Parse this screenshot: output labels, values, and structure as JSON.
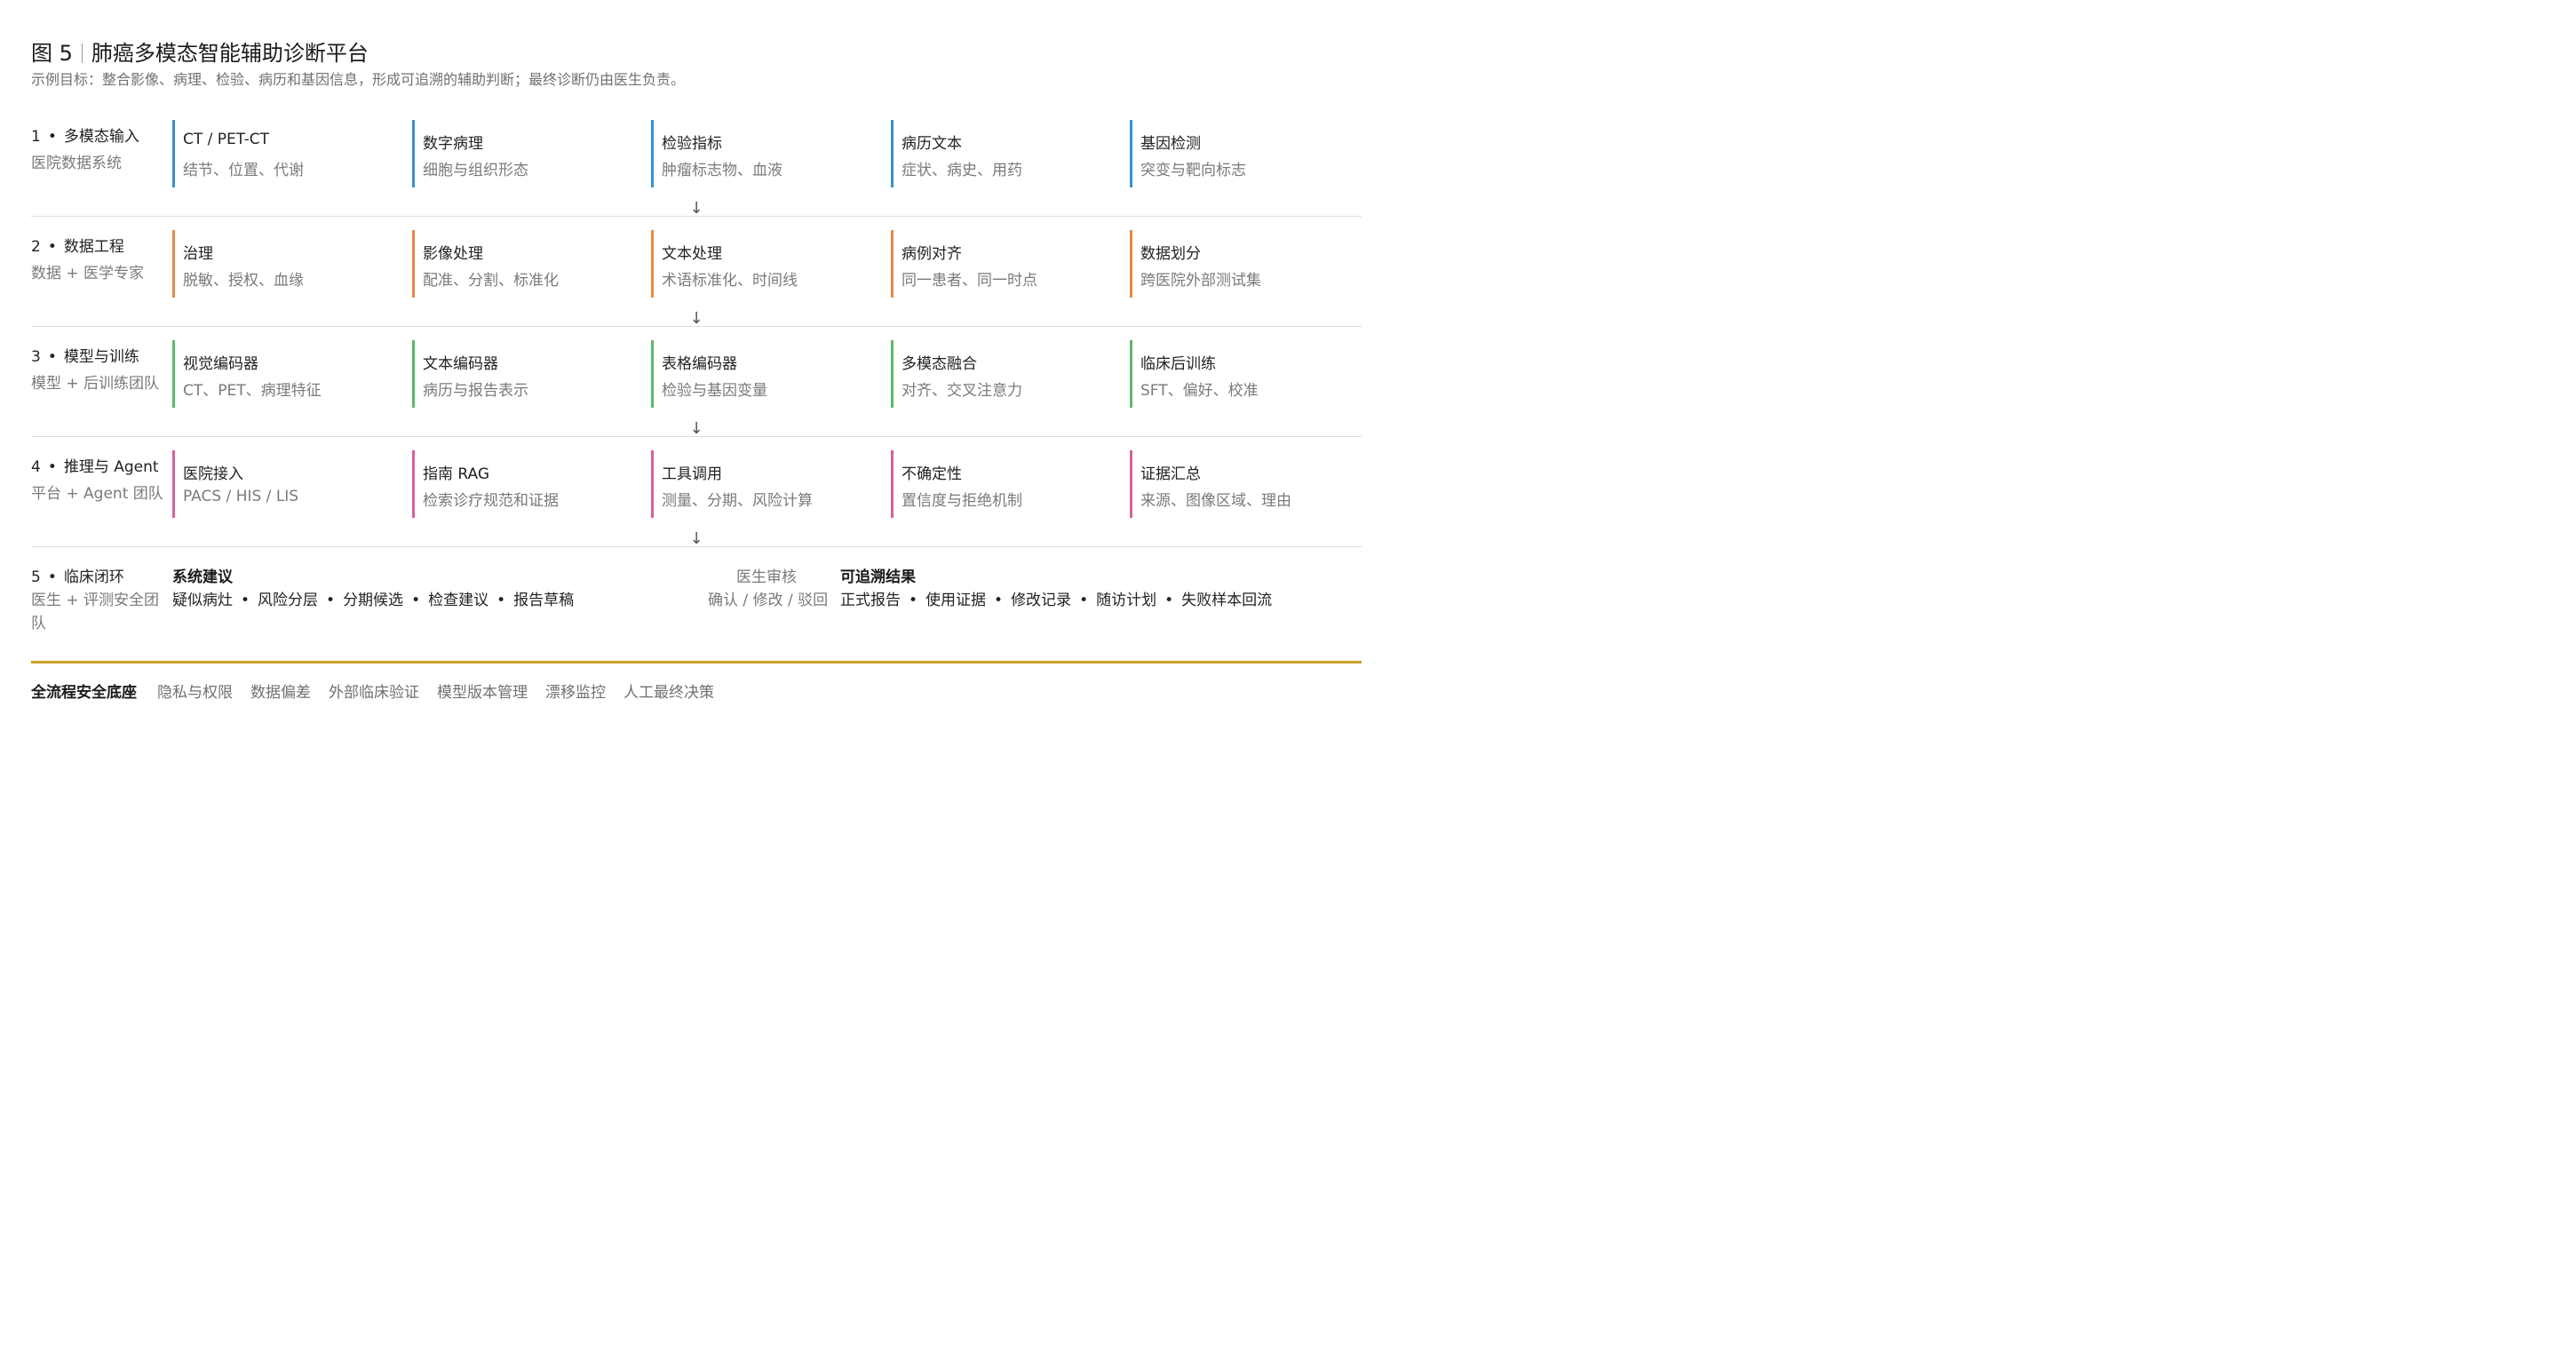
{
  "figure": {
    "number": "图 5",
    "title": "肺癌多模态智能辅助诊断平台",
    "subtitle": "示例目标：整合影像、病理、检验、病历和基因信息，形成可追溯的辅助判断；最终诊断仍由医生负责。"
  },
  "connector_arrow": "↓",
  "stages": [
    {
      "num": "1",
      "name": "多模态输入",
      "owner": "医院数据系统",
      "color": "#3a8fd0",
      "cards": [
        {
          "title": "CT / PET-CT",
          "desc": "结节、位置、代谢"
        },
        {
          "title": "数字病理",
          "desc": "细胞与组织形态"
        },
        {
          "title": "检验指标",
          "desc": "肿瘤标志物、血液"
        },
        {
          "title": "病历文本",
          "desc": "症状、病史、用药"
        },
        {
          "title": "基因检测",
          "desc": "突变与靶向标志"
        }
      ]
    },
    {
      "num": "2",
      "name": "数据工程",
      "owner": "数据 + 医学专家",
      "color": "#e8874a",
      "cards": [
        {
          "title": "治理",
          "desc": "脱敏、授权、血缘"
        },
        {
          "title": "影像处理",
          "desc": "配准、分割、标准化"
        },
        {
          "title": "文本处理",
          "desc": "术语标准化、时间线"
        },
        {
          "title": "病例对齐",
          "desc": "同一患者、同一时点"
        },
        {
          "title": "数据划分",
          "desc": "跨医院外部测试集"
        }
      ]
    },
    {
      "num": "3",
      "name": "模型与训练",
      "owner": "模型 + 后训练团队",
      "color": "#5cb86e",
      "cards": [
        {
          "title": "视觉编码器",
          "desc": "CT、PET、病理特征"
        },
        {
          "title": "文本编码器",
          "desc": "病历与报告表示"
        },
        {
          "title": "表格编码器",
          "desc": "检验与基因变量"
        },
        {
          "title": "多模态融合",
          "desc": "对齐、交叉注意力"
        },
        {
          "title": "临床后训练",
          "desc": "SFT、偏好、校准"
        }
      ]
    },
    {
      "num": "4",
      "name": "推理与 Agent",
      "owner": "平台 + Agent 团队",
      "color": "#d9609a",
      "cards": [
        {
          "title": "医院接入",
          "desc": "PACS / HIS / LIS"
        },
        {
          "title": "指南 RAG",
          "desc": "检索诊疗规范和证据"
        },
        {
          "title": "工具调用",
          "desc": "测量、分期、风险计算"
        },
        {
          "title": "不确定性",
          "desc": "置信度与拒绝机制"
        },
        {
          "title": "证据汇总",
          "desc": "来源、图像区域、理由"
        }
      ]
    }
  ],
  "stage5": {
    "num": "5",
    "name": "临床闭环",
    "owner": "医生 + 评测安全团队",
    "suggestion_title": "系统建议",
    "suggestions": [
      "疑似病灶",
      "风险分层",
      "分期候选",
      "检查建议",
      "报告草稿"
    ],
    "review_title": "医生审核",
    "review_actions": "确认 / 修改 / 驳回",
    "result_title": "可追溯结果",
    "results": [
      "正式报告",
      "使用证据",
      "修改记录",
      "随访计划",
      "失败样本回流"
    ]
  },
  "footer": {
    "label": "全流程安全底座",
    "items": [
      "隐私与权限",
      "数据偏差",
      "外部临床验证",
      "模型版本管理",
      "漂移监控",
      "人工最终决策"
    ]
  },
  "bullet": "•"
}
